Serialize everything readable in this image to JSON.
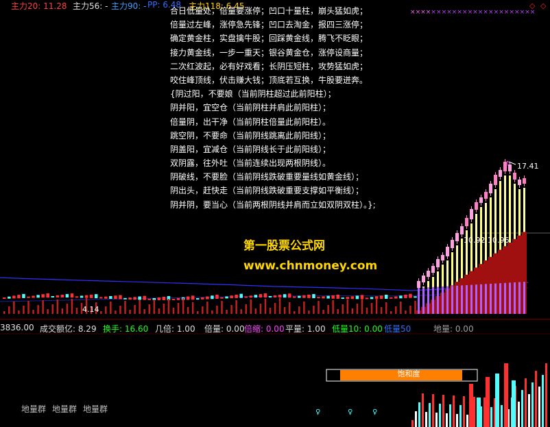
{
  "header": {
    "zl20": "主力20: 11.28",
    "zl56": "主力56: -",
    "zl90": "主力90: -",
    "pp": "PP: 6.48",
    "zl118": "主力118: 6.45"
  },
  "poem": [
    "合日低量处，倍量要涨停；凹口十量柱，崩头猛如虎；",
    "倍量过左峰，涨停急先锋；凹口去淘金，报四三涨停；",
    "确定黄金柱，实盘擒牛股；回踩黄金线，腾飞不眨眼；",
    "接力黄金线，一步一重天；银谷黄金仓，涨停设商量；",
    "二次红波起，必有好戏看；长阴压短柱，攻势猛如虎；",
    "咬住峰顶线，伏击赚大钱；顶底若互换，牛股要迸奔。",
    "{阴过阳，不要娘（当前阴柱超过此前阳柱）；",
    "阴并阳，宜空仓（当前阴柱并肩此前阳柱）；",
    "倍量阴，出干净（当前阴柱倍量此前阳柱）。",
    "跳空阴，不要命（当前阴线跳离此前阳线）；",
    "阴盖阳，宜减仓（当前阴线长于此前阳线）；",
    "双阴露，往外吐（当前连续出现两根阴线）。",
    "阴破线，不要脸（当前阴线跌破重要量线如黄金线）；",
    "阴出头，赶快走（当前阴线跌破重要支撑如平衡线）；",
    "阴并阴，要当心（当前两根阴线并肩而立如双阴双柱）。};"
  ],
  "brand": {
    "name": "第一股票公式网",
    "url": "www.chnmoney.com"
  },
  "prices": {
    "high": "17.41",
    "mid": "10.92 10.96",
    "low": "4.14"
  },
  "indicators": {
    "vol": "3836.00",
    "amount": "成交额亿: 8.29",
    "turnover": "换手: 16.60",
    "jibei": "几倍: 1.00",
    "beiliang": "倍量: 0.00",
    "beisuo": "倍缩: 0.00",
    "pingliang": "平量: 1.00",
    "diliang10": "低量10: 0.00",
    "diliang50": "低量50",
    "diliang": "地量: 0.00"
  },
  "bottom": {
    "diliang_groups": [
      "地量群",
      "地量群",
      "地量群"
    ],
    "saturation": "饱和度"
  },
  "colors": {
    "up": "#ff3232",
    "down": "#54fcfc",
    "pink": "#ffa0e0",
    "yellow": "#ffff80",
    "purple": "#b060ff",
    "blue_line": "#3030ff",
    "orange": "#ff8000"
  }
}
